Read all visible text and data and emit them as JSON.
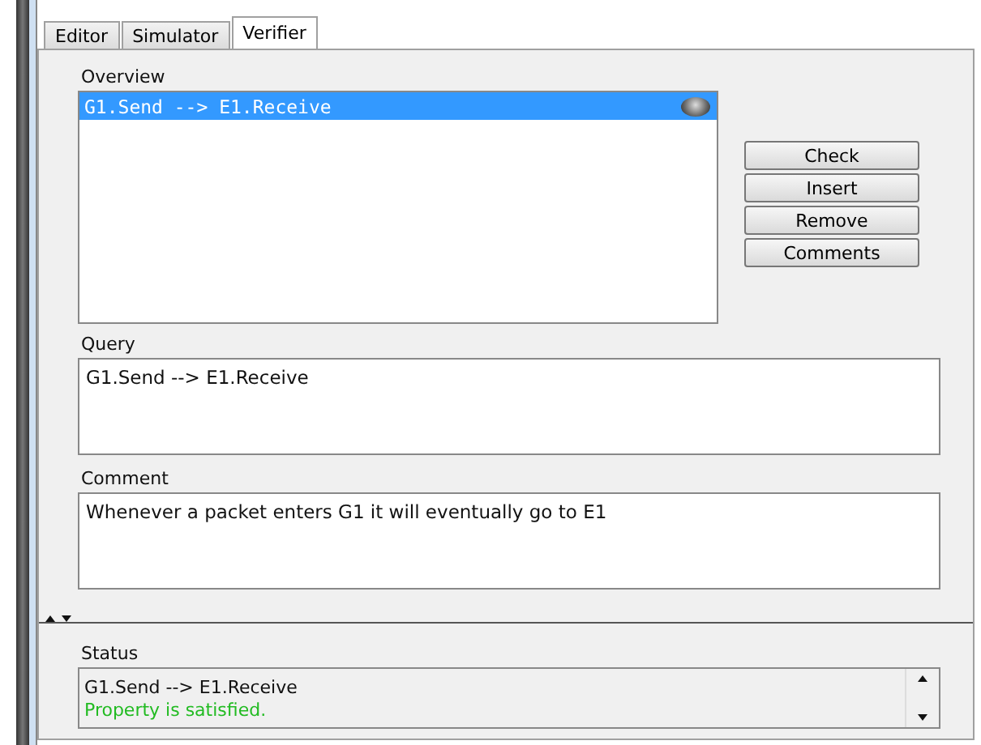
{
  "tabs": [
    {
      "label": "Editor",
      "selected": false
    },
    {
      "label": "Simulator",
      "selected": false
    },
    {
      "label": "Verifier",
      "selected": true
    }
  ],
  "overview": {
    "label": "Overview",
    "items": [
      {
        "text": "G1.Send --> E1.Receive",
        "selected": true
      }
    ]
  },
  "buttons": [
    "Check",
    "Insert",
    "Remove",
    "Comments"
  ],
  "query": {
    "label": "Query",
    "value": "G1.Send --> E1.Receive"
  },
  "comment": {
    "label": "Comment",
    "value": "Whenever a packet enters G1 it will eventually go to E1"
  },
  "status": {
    "label": "Status",
    "lines": [
      {
        "text": "G1.Send --> E1.Receive",
        "kind": "query"
      },
      {
        "text": "Property is satisfied.",
        "kind": "result"
      }
    ]
  }
}
